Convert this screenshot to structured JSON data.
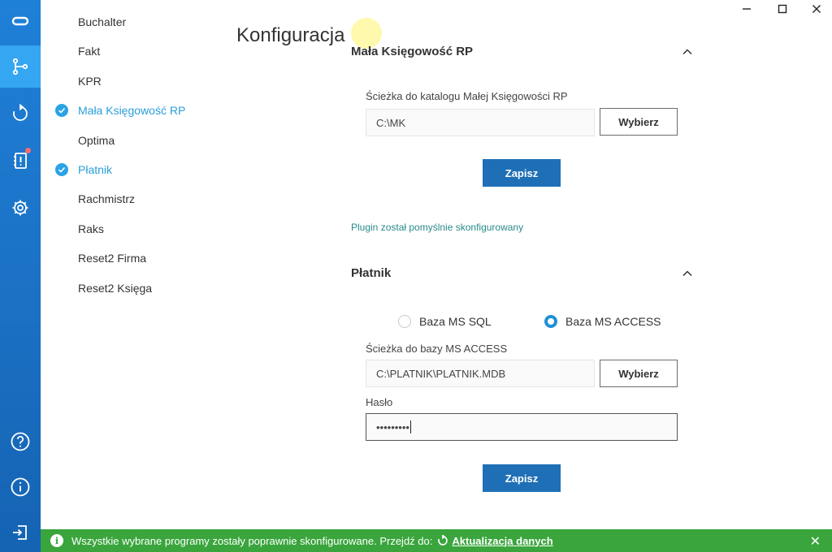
{
  "window": {
    "minimize": "—",
    "maximize": "☐",
    "close": "✕"
  },
  "rail": {
    "icons": [
      "link-icon",
      "branch-icon",
      "refresh-icon",
      "notebook-alert-icon",
      "gear-icon",
      "help-icon",
      "info-icon",
      "logout-icon"
    ],
    "active": "branch-icon",
    "accent": "#35a6f2"
  },
  "plugins": [
    {
      "label": "Buchalter",
      "checked": false
    },
    {
      "label": "Fakt",
      "checked": false
    },
    {
      "label": "KPR",
      "checked": false
    },
    {
      "label": "Mała Księgowość RP",
      "checked": true
    },
    {
      "label": "Optima",
      "checked": false
    },
    {
      "label": "Płatnik",
      "checked": true
    },
    {
      "label": "Rachmistrz",
      "checked": false
    },
    {
      "label": "Raks",
      "checked": false
    },
    {
      "label": "Reset2 Firma",
      "checked": false
    },
    {
      "label": "Reset2 Księga",
      "checked": false
    }
  ],
  "main": {
    "title": "Konfiguracja",
    "mkrp": {
      "section_title": "Mała Księgowość RP",
      "path_label": "Ścieżka do katalogu Małej Księgowości RP",
      "path_value": "C:\\MK",
      "browse_label": "Wybierz",
      "save_label": "Zapisz",
      "success": "Plugin został pomyślnie skonfigurowany"
    },
    "platnik": {
      "section_title": "Płatnik",
      "radio_sql": "Baza MS SQL",
      "radio_access": "Baza MS ACCESS",
      "selected": "Baza MS ACCESS",
      "path_label": "Ścieżka do bazy MS ACCESS",
      "path_value": "C:\\PLATNIK\\PLATNIK.MDB",
      "browse_label": "Wybierz",
      "password_label": "Hasło",
      "password_value": "•••••••••",
      "save_label": "Zapisz"
    }
  },
  "status_bar": {
    "message": "Wszystkie wybrane programy zostały poprawnie skonfigurowane. Przejdź do:",
    "link": "Aktualizacja danych",
    "close": "✕",
    "color": "#3aa53d"
  }
}
